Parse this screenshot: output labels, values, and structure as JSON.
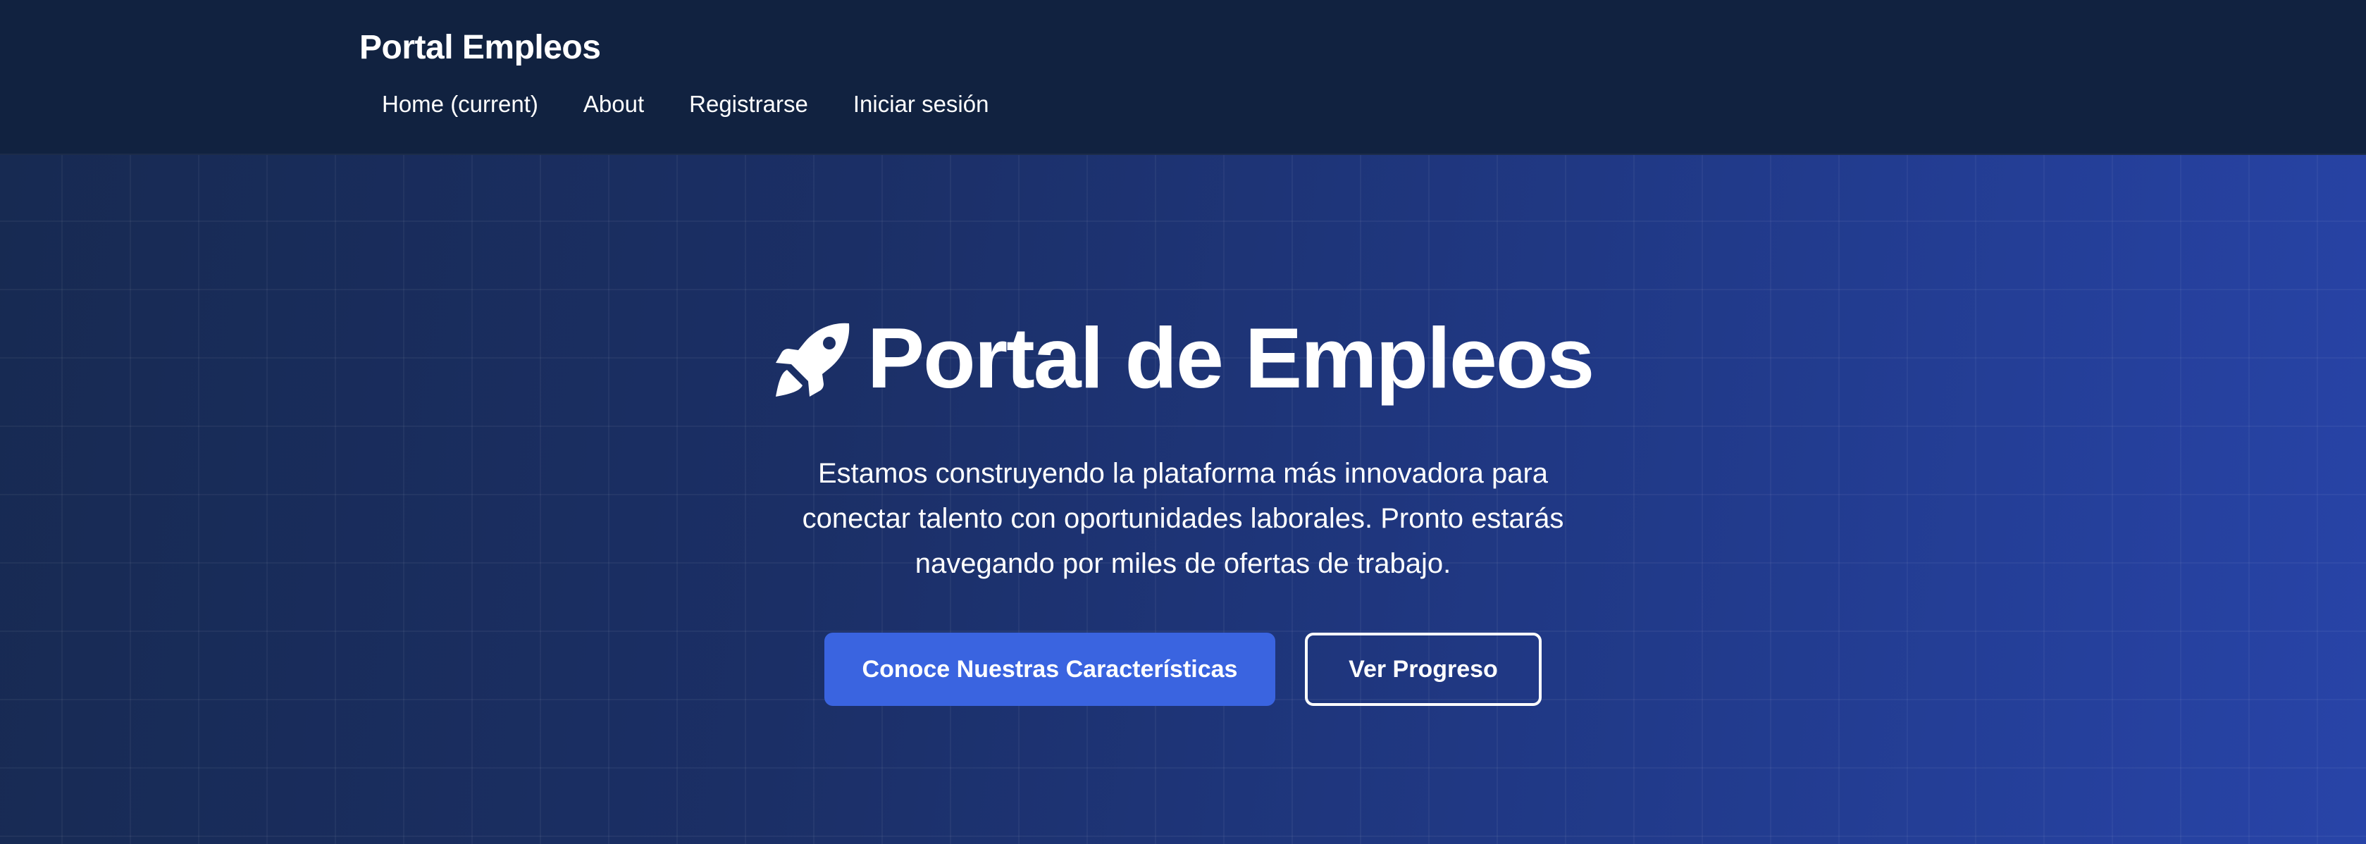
{
  "header": {
    "brand": "Portal Empleos",
    "nav": [
      {
        "label": "Home (current)"
      },
      {
        "label": "About"
      },
      {
        "label": "Registrarse"
      },
      {
        "label": "Iniciar sesión"
      }
    ]
  },
  "hero": {
    "icon": "rocket-icon",
    "title": "Portal de Empleos",
    "description": "Estamos construyendo la plataforma más innovadora para conectar talento con oportunidades laborales. Pronto estarás navegando por miles de ofertas de trabajo.",
    "primary_button": "Conoce Nuestras Características",
    "secondary_button": "Ver Progreso"
  },
  "colors": {
    "navbar_bg": "#112240",
    "hero_gradient_start": "#172a52",
    "hero_gradient_end": "#2844a8",
    "primary_button": "#3a64e0",
    "text": "#ffffff"
  }
}
